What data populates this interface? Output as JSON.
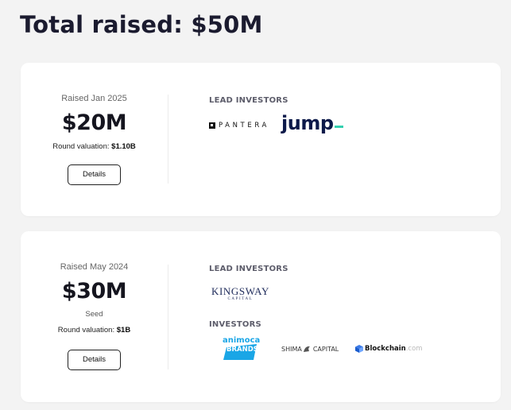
{
  "page": {
    "title": "Total raised: $50M"
  },
  "rounds": [
    {
      "raised_date": "Raised Jan 2025",
      "amount": "$20M",
      "stage": "",
      "valuation_label": "Round valuation: ",
      "valuation_value": "$1.10B",
      "details_label": "Details",
      "lead_label": "LEAD INVESTORS",
      "lead_investors": [
        "PANTERA",
        "jump"
      ],
      "investors_label": "",
      "investors": []
    },
    {
      "raised_date": "Raised May 2024",
      "amount": "$30M",
      "stage": "Seed",
      "valuation_label": "Round valuation: ",
      "valuation_value": "$1B",
      "details_label": "Details",
      "lead_label": "LEAD INVESTORS",
      "lead_investors": [
        "KINGSWAY",
        "CAPITAL"
      ],
      "investors_label": "INVESTORS",
      "investors": [
        "animoca",
        "BRANDS",
        "SHIMA",
        "CAPITAL",
        "Blockchain",
        ".com"
      ]
    }
  ],
  "colors": {
    "background": "#f3f3f3",
    "card": "#ffffff",
    "jump_accent": "#35d0b0",
    "jump_text": "#0d1a4a",
    "animoca_blue": "#1aa6e6",
    "blockchain_blue": "#1a5ccc",
    "kingsway_navy": "#1e2a5a"
  }
}
